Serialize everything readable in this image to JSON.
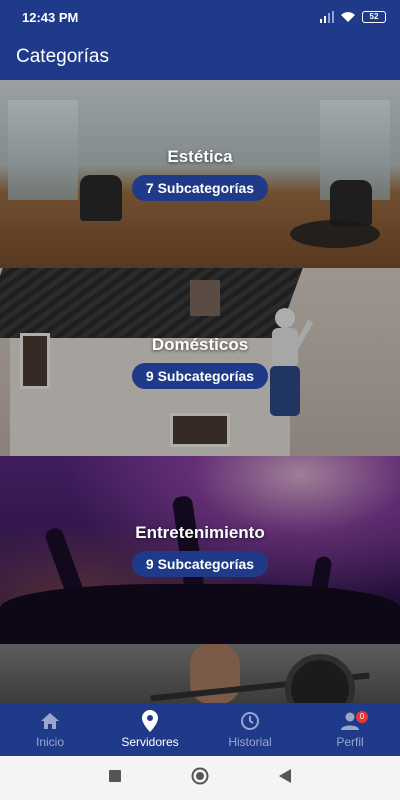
{
  "status_bar": {
    "time": "12:43 PM",
    "battery": "52"
  },
  "app_bar": {
    "title": "Categorías"
  },
  "categories": [
    {
      "title": "Estética",
      "badge": "7 Subcategorías"
    },
    {
      "title": "Domésticos",
      "badge": "9 Subcategorías"
    },
    {
      "title": "Entretenimiento",
      "badge": "9 Subcategorías"
    }
  ],
  "bottom_nav": {
    "items": [
      {
        "label": "Inicio",
        "icon": "home-icon"
      },
      {
        "label": "Servidores",
        "icon": "location-pin-icon",
        "active": true
      },
      {
        "label": "Historial",
        "icon": "clock-icon"
      },
      {
        "label": "Perfil",
        "icon": "person-icon",
        "badge": "0"
      }
    ]
  },
  "colors": {
    "primary": "#203a8a",
    "inactive": "#9aa6cc",
    "badge": "#e53935"
  }
}
